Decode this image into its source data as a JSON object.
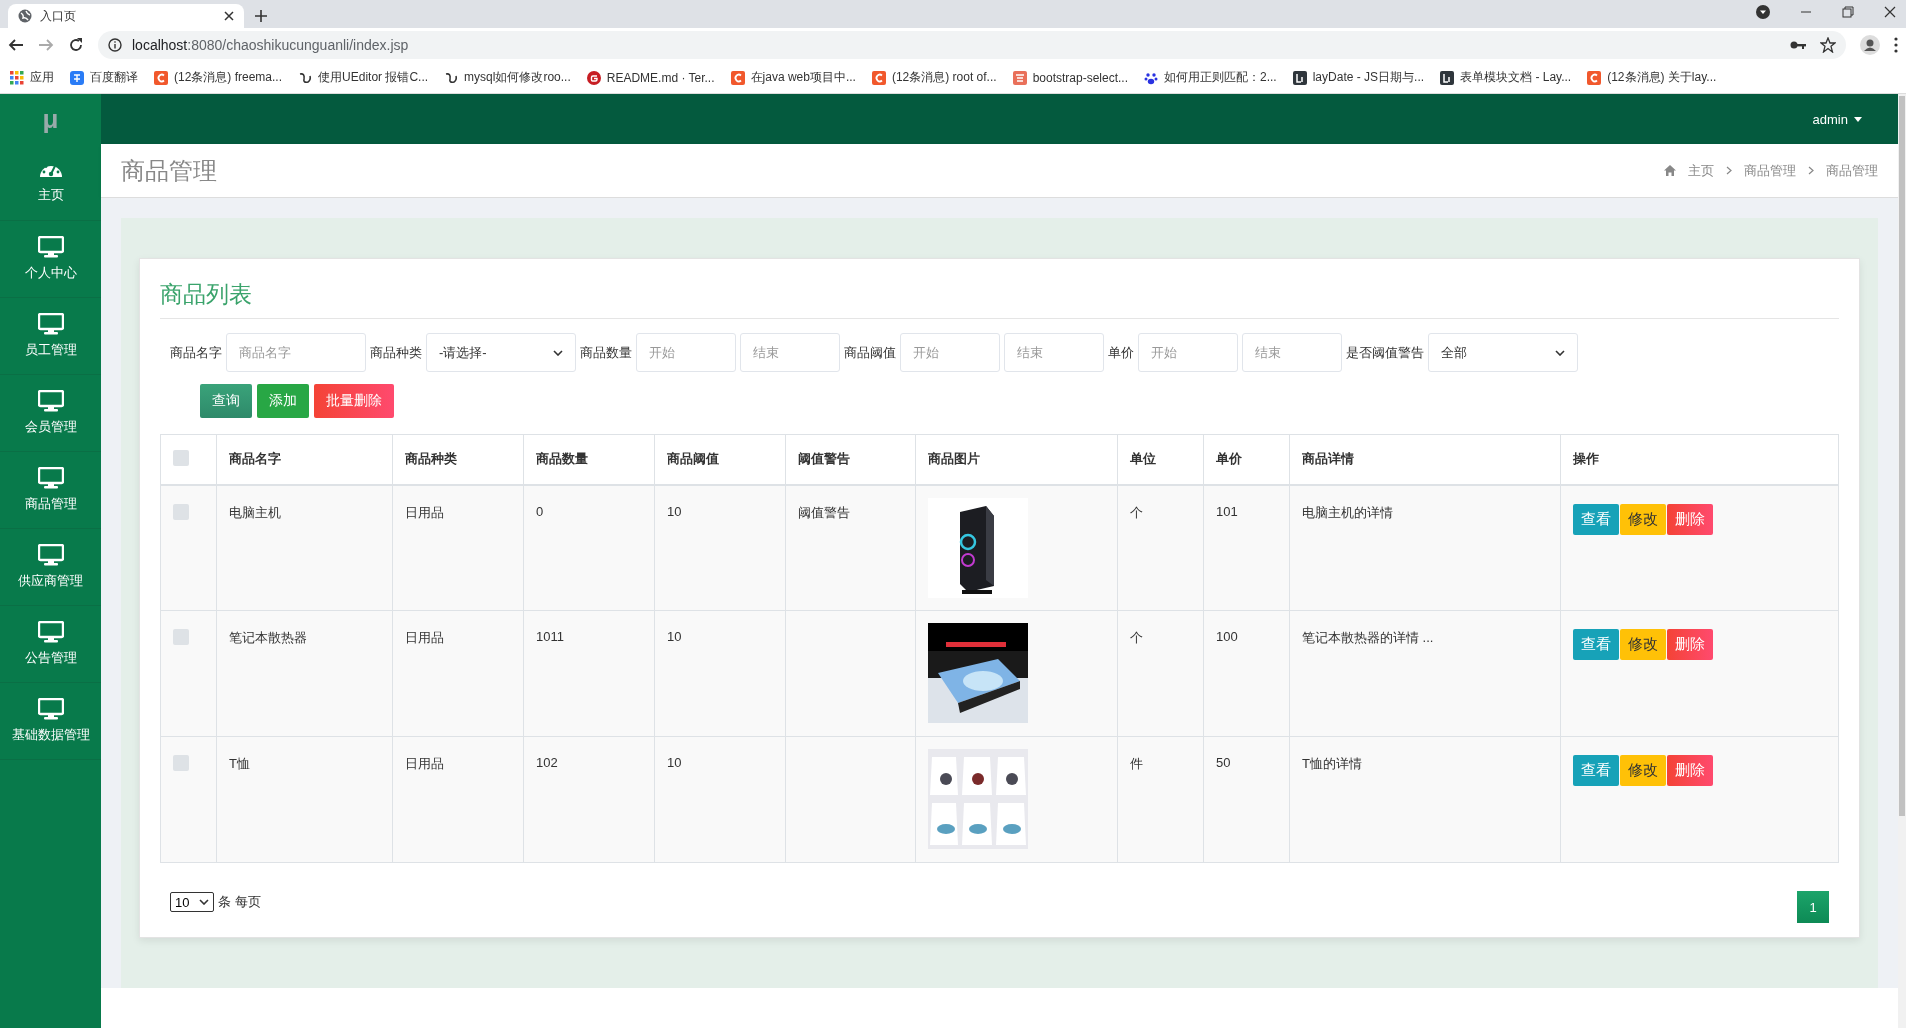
{
  "browser": {
    "tabs": [
      {
        "title": "入口页",
        "selected": true
      }
    ],
    "url": {
      "host": "localhost",
      "rest": ":8080/chaoshikucunguanli/index.jsp"
    },
    "bookmarks": [
      {
        "kind": "apps",
        "label": "应用"
      },
      {
        "kind": "translate",
        "label": "百度翻译"
      },
      {
        "kind": "csdn",
        "label": "(12条消息) freema..."
      },
      {
        "kind": "ueditor",
        "label": "使用UEditor 报错C..."
      },
      {
        "kind": "ueditor",
        "label": "mysql如何修改roo..."
      },
      {
        "kind": "gitee",
        "label": "README.md · Ter..."
      },
      {
        "kind": "csdn",
        "label": "在java web项目中..."
      },
      {
        "kind": "csdn",
        "label": "(12条消息) root of..."
      },
      {
        "kind": "jianshu",
        "label": "bootstrap-select..."
      },
      {
        "kind": "baidu",
        "label": "如何用正则匹配：2..."
      },
      {
        "kind": "layui",
        "label": "layDate - JS日期与..."
      },
      {
        "kind": "layui",
        "label": "表单模块文档 - Lay..."
      },
      {
        "kind": "csdn",
        "label": "(12条消息) 关于lay..."
      }
    ]
  },
  "logo": "μ",
  "user": "admin",
  "sidebar": {
    "items": [
      {
        "kind": "dashboard",
        "label": "主页"
      },
      {
        "kind": "monitor",
        "label": "个人中心"
      },
      {
        "kind": "monitor",
        "label": "员工管理"
      },
      {
        "kind": "monitor",
        "label": "会员管理"
      },
      {
        "kind": "monitor",
        "label": "商品管理"
      },
      {
        "kind": "monitor",
        "label": "供应商管理"
      },
      {
        "kind": "monitor",
        "label": "公告管理"
      },
      {
        "kind": "monitor",
        "label": "基础数据管理"
      }
    ]
  },
  "page_title": "商品管理",
  "breadcrumbs": [
    "主页",
    "商品管理",
    "商品管理"
  ],
  "card_title": "商品列表",
  "filters": [
    {
      "kind": "text",
      "label": "商品名字",
      "placeholder": "商品名字"
    },
    {
      "kind": "select",
      "label": "商品种类",
      "value": "-请选择-"
    },
    {
      "kind": "range",
      "label": "商品数量",
      "placeholders": [
        "开始",
        "结束"
      ]
    },
    {
      "kind": "range",
      "label": "商品阈值",
      "placeholders": [
        "开始",
        "结束"
      ]
    },
    {
      "kind": "range",
      "label": "单价",
      "placeholders": [
        "开始",
        "结束"
      ]
    },
    {
      "kind": "select",
      "label": "是否阈值警告",
      "value": "全部"
    }
  ],
  "buttons": [
    {
      "kind": "search",
      "label": "查询"
    },
    {
      "kind": "add",
      "label": "添加"
    },
    {
      "kind": "delete",
      "label": "批量删除"
    }
  ],
  "table": {
    "select_all": {
      "checked": false
    },
    "columns": [
      "商品名字",
      "商品种类",
      "商品数量",
      "商品阈值",
      "阈值警告",
      "商品图片",
      "单位",
      "单价",
      "商品详情",
      "操作"
    ],
    "rows": [
      {
        "checked": false,
        "cells": [
          "电脑主机",
          "日用品",
          "0",
          "10",
          "阈值警告",
          {
            "kind": "picture"
          },
          "个",
          "101",
          "电脑主机的详情"
        ],
        "actions": [
          {
            "kind": "view",
            "label": "查看"
          },
          {
            "kind": "edit",
            "label": "修改"
          },
          {
            "kind": "delete",
            "label": "删除"
          }
        ]
      },
      {
        "checked": false,
        "cells": [
          "笔记本散热器",
          "日用品",
          "1011",
          "10",
          "",
          {
            "kind": "picture"
          },
          "个",
          "100",
          "笔记本散热器的详情 ..."
        ],
        "actions": [
          {
            "kind": "view",
            "label": "查看"
          },
          {
            "kind": "edit",
            "label": "修改"
          },
          {
            "kind": "delete",
            "label": "删除"
          }
        ]
      },
      {
        "checked": false,
        "cells": [
          "T恤",
          "日用品",
          "102",
          "10",
          "",
          {
            "kind": "picture"
          },
          "件",
          "50",
          "T恤的详情"
        ],
        "actions": [
          {
            "kind": "view",
            "label": "查看"
          },
          {
            "kind": "edit",
            "label": "修改"
          },
          {
            "kind": "delete",
            "label": "删除"
          }
        ]
      }
    ]
  },
  "pagination": {
    "page_size": "10",
    "page_size_suffix": "条 每页",
    "pages": [
      {
        "label": "1",
        "selected": true
      }
    ]
  }
}
